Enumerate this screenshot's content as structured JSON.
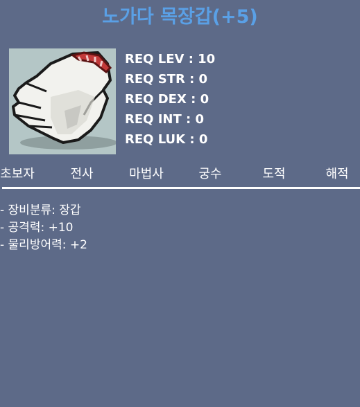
{
  "item": {
    "title": "노가다 목장갑(+5)",
    "image_icon": "white-work-glove-icon",
    "background_color": "#5d6a88",
    "title_color": "#5aa0e6"
  },
  "requirements": [
    "REQ LEV : 10",
    "REQ STR : 0",
    "REQ DEX : 0",
    "REQ INT : 0",
    "REQ LUK : 0"
  ],
  "jobs": [
    "초보자",
    "전사",
    "마법사",
    "궁수",
    "도적",
    "해적"
  ],
  "stats": [
    "- 장비분류: 장갑",
    "- 공격력: +10",
    "- 물리방어력: +2"
  ]
}
